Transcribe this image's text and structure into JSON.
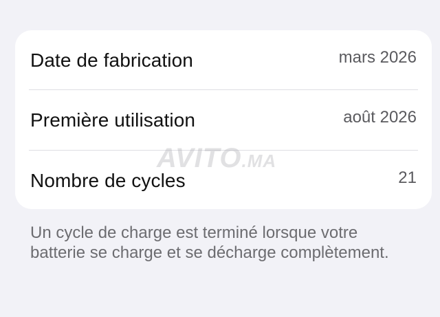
{
  "battery_info": {
    "rows": [
      {
        "label": "Date de fabrication",
        "value": "mars 2026"
      },
      {
        "label": "Première utilisation",
        "value": "août 2026"
      },
      {
        "label": "Nombre de cycles",
        "value": "21"
      }
    ]
  },
  "watermark": {
    "text": "AVITO",
    "suffix": ".MA"
  },
  "footnote": "Un cycle de charge est terminé lorsque votre batterie se charge et se décharge complètement.",
  "colors": {
    "background": "#f2f2f7",
    "card": "#ffffff",
    "label_text": "#111111",
    "value_text": "#5a5a5e",
    "footnote_text": "#6c6c70"
  }
}
